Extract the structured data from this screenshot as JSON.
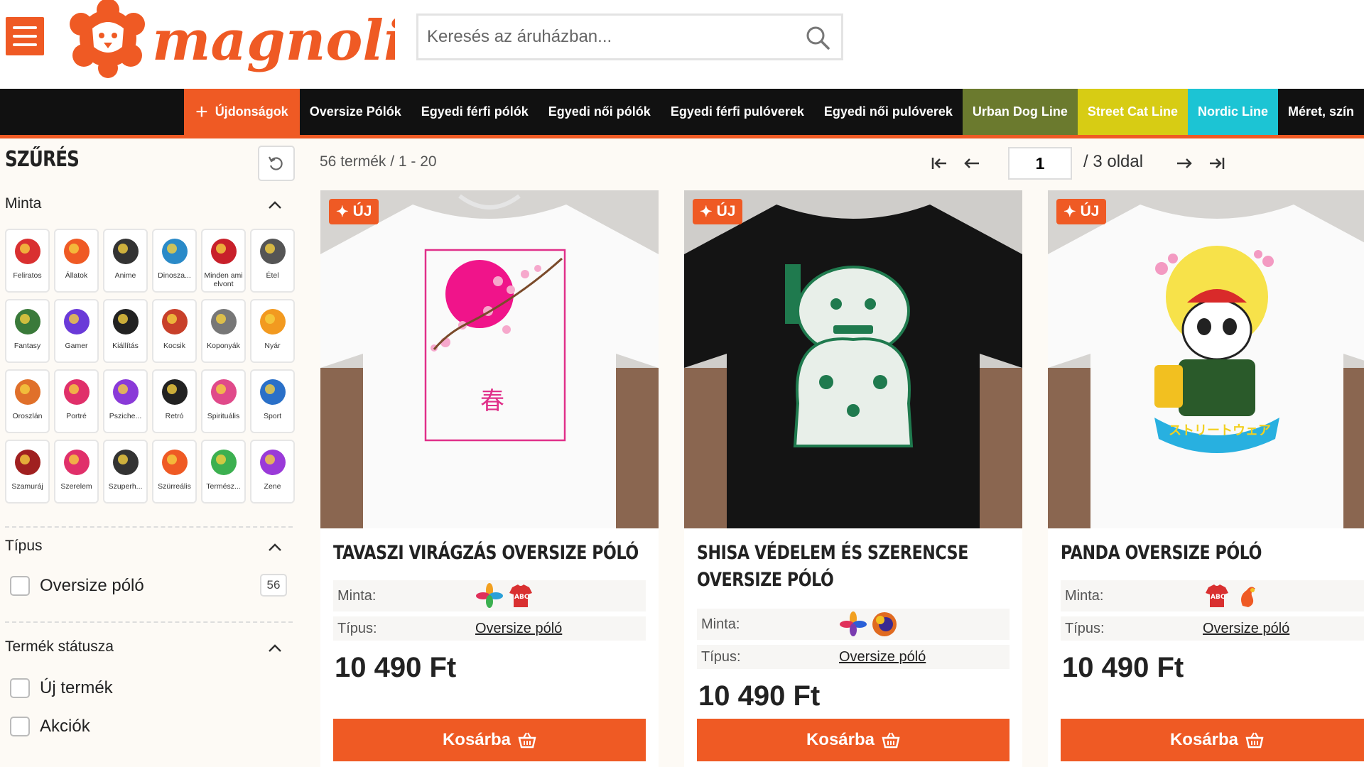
{
  "header": {
    "logo_text": "magnolion",
    "search_placeholder": "Keresés az áruházban..."
  },
  "nav": {
    "items": [
      {
        "label": "Újdonságok"
      },
      {
        "label": "Oversize Pólók"
      },
      {
        "label": "Egyedi férfi pólók"
      },
      {
        "label": "Egyedi női pólók"
      },
      {
        "label": "Egyedi férfi pulóverek"
      },
      {
        "label": "Egyedi női pulóverek"
      },
      {
        "label": "Urban Dog Line"
      },
      {
        "label": "Street Cat Line"
      },
      {
        "label": "Nordic Line"
      },
      {
        "label": "Méret, szín"
      }
    ],
    "colors": {
      "accent": "#ef5a24",
      "urban": "#6b7a2e",
      "cat": "#d7cc14",
      "nordic": "#1cc4d4"
    }
  },
  "sidebar": {
    "title": "SZŰRÉS",
    "minta": {
      "label": "Minta",
      "tiles": [
        {
          "label": "Feliratos",
          "icon": "abc-shirt-icon"
        },
        {
          "label": "Állatok",
          "icon": "animal-icon"
        },
        {
          "label": "Anime",
          "icon": "anime-icon"
        },
        {
          "label": "Dinosza...",
          "icon": "dinosaur-icon"
        },
        {
          "label": "Minden ami elvont",
          "icon": "abstract-icon"
        },
        {
          "label": "Étel",
          "icon": "food-icon"
        },
        {
          "label": "Fantasy",
          "icon": "dragon-icon"
        },
        {
          "label": "Gamer",
          "icon": "gamepad-icon"
        },
        {
          "label": "Kiállítás",
          "icon": "triangle-icon"
        },
        {
          "label": "Kocsik",
          "icon": "car-icon"
        },
        {
          "label": "Koponyák",
          "icon": "skull-icon"
        },
        {
          "label": "Nyár",
          "icon": "palm-icon"
        },
        {
          "label": "Oroszlán",
          "icon": "lion-icon"
        },
        {
          "label": "Portré",
          "icon": "portrait-icon"
        },
        {
          "label": "Psziche...",
          "icon": "psychedelic-icon"
        },
        {
          "label": "Retró",
          "icon": "vinyl-icon"
        },
        {
          "label": "Spirituális",
          "icon": "lotus-icon"
        },
        {
          "label": "Sport",
          "icon": "runner-icon"
        },
        {
          "label": "Szamuráj",
          "icon": "samurai-icon"
        },
        {
          "label": "Szerelem",
          "icon": "heart-icon"
        },
        {
          "label": "Szuperh...",
          "icon": "superhero-icon"
        },
        {
          "label": "Szürreális",
          "icon": "surreal-icon"
        },
        {
          "label": "Termész...",
          "icon": "nature-icon"
        },
        {
          "label": "Zene",
          "icon": "treble-clef-icon"
        }
      ]
    },
    "tipus": {
      "label": "Típus",
      "options": [
        {
          "label": "Oversize póló",
          "count": "56"
        }
      ]
    },
    "status": {
      "label": "Termék státusza",
      "options": [
        {
          "label": "Új termék"
        },
        {
          "label": "Akciók"
        }
      ]
    }
  },
  "toolbar": {
    "result_text": "56 termék / 1 -  20",
    "page_value": "1",
    "page_total": "/  3 oldal"
  },
  "products": [
    {
      "badge": "ÚJ",
      "title": "Tavaszi virágzás oversize póló",
      "minta_label": "Minta:",
      "tipus_label": "Típus:",
      "tipus_value": "Oversize póló",
      "price": "10 490 Ft",
      "cart_label": "Kosárba"
    },
    {
      "badge": "ÚJ",
      "title": "Shisa védelem és szerencse oversize póló",
      "minta_label": "Minta:",
      "tipus_label": "Típus:",
      "tipus_value": "Oversize póló",
      "price": "10 490 Ft",
      "cart_label": "Kosárba"
    },
    {
      "badge": "ÚJ",
      "title": "Panda oversize póló",
      "minta_label": "Minta:",
      "tipus_label": "Típus:",
      "tipus_value": "Oversize póló",
      "price": "10 490 Ft",
      "cart_label": "Kosárba"
    }
  ]
}
